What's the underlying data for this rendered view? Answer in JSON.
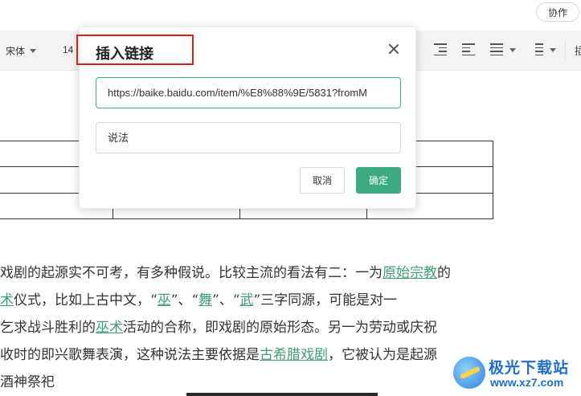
{
  "topbar": {
    "collab_label": "协作"
  },
  "toolbar": {
    "font_family": "宋体",
    "font_size": "14",
    "overflow_label": "插"
  },
  "dialog": {
    "title": "插入链接",
    "url_value": "https://baike.baidu.com/item/%E8%88%9E/5831?fromM",
    "text_value": "说法",
    "cancel_label": "取消",
    "ok_label": "确定",
    "accent_color": "#3dab82",
    "highlight_color": "#d9201e"
  },
  "document": {
    "lines": [
      {
        "segments": [
          {
            "t": "戏剧的起源实不可考，有多种假说。比较主流的看法有二：一为"
          },
          {
            "t": "原始宗教",
            "link": true
          },
          {
            "t": "的"
          }
        ]
      },
      {
        "segments": [
          {
            "t": "术",
            "link": true
          },
          {
            "t": "仪式，比如上古中文，“"
          },
          {
            "t": "巫",
            "link": true
          },
          {
            "t": "”、“"
          },
          {
            "t": "舞",
            "link": true
          },
          {
            "t": "”、“"
          },
          {
            "t": "武",
            "link": true
          },
          {
            "t": "”三字同源，可能是对一"
          }
        ]
      },
      {
        "segments": [
          {
            "t": "乞求战斗胜利的"
          },
          {
            "t": "巫术",
            "link": true
          },
          {
            "t": "活动的合称，即戏剧的原始形态。另一为劳动或庆祝"
          }
        ]
      },
      {
        "segments": [
          {
            "t": "收时的即兴歌舞表演，这种说法主要依据是"
          },
          {
            "t": "古希腊戏剧",
            "link": true
          },
          {
            "t": "，它被认为是起源"
          }
        ]
      },
      {
        "segments": [
          {
            "t": "酒神祭祀"
          }
        ]
      }
    ],
    "link_color": "#3f9f74"
  },
  "watermark": {
    "title": "极光下载站",
    "url": "www.xz7.com"
  }
}
